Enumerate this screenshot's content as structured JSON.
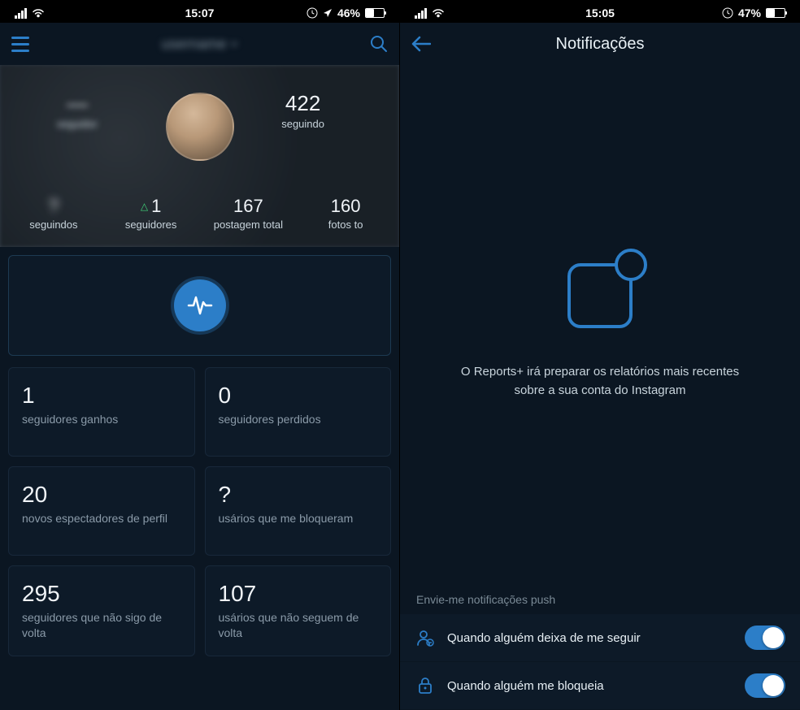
{
  "left": {
    "status": {
      "time": "15:07",
      "battery_pct": "46%",
      "battery_fill": 46
    },
    "nav": {
      "username": "username"
    },
    "header": {
      "follower": {
        "num": "—",
        "label": "seguidor"
      },
      "following": {
        "num": "422",
        "label": "seguindo"
      },
      "row2": [
        {
          "num": "?",
          "label": "seguindos",
          "blurred": true
        },
        {
          "num": "1",
          "label": "seguidores",
          "delta": "△"
        },
        {
          "num": "167",
          "label": "postagem total"
        },
        {
          "num": "160",
          "label": "fotos to"
        }
      ]
    },
    "cards": [
      {
        "num": "1",
        "label": "seguidores ganhos"
      },
      {
        "num": "0",
        "label": "seguidores perdidos"
      },
      {
        "num": "20",
        "label": "novos espectadores de perfil"
      },
      {
        "num": "?",
        "label": "usários que me bloqueram"
      },
      {
        "num": "295",
        "label": "seguidores que não sigo de volta"
      },
      {
        "num": "107",
        "label": "usários que não seguem de volta"
      }
    ]
  },
  "right": {
    "status": {
      "time": "15:05",
      "battery_pct": "47%",
      "battery_fill": 47
    },
    "nav": {
      "title": "Notificações"
    },
    "empty_text": "O Reports+ irá preparar os relatórios mais recentes sobre a sua conta do Instagram",
    "section_label": "Envie-me notificações push",
    "toggles": [
      {
        "label": "Quando alguém deixa de me seguir"
      },
      {
        "label": "Quando alguém me bloqueia"
      }
    ]
  }
}
